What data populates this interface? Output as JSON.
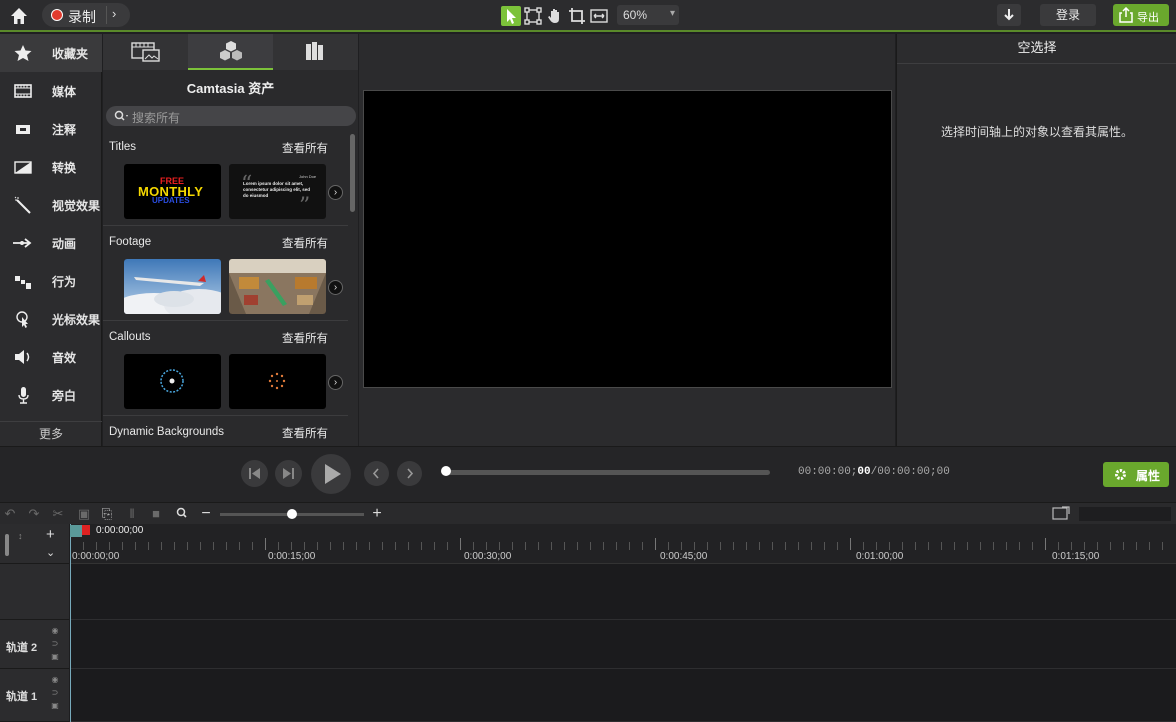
{
  "topbar": {
    "record_label": "录制",
    "zoom": "60%",
    "login_label": "登录",
    "export_label": "导出",
    "tools": [
      "select-icon",
      "transform-icon",
      "pan-icon",
      "crop-icon",
      "fit-icon"
    ]
  },
  "nav": {
    "items": [
      {
        "label": "收藏夹",
        "icon": "star-icon"
      },
      {
        "label": "媒体",
        "icon": "film-icon"
      },
      {
        "label": "注释",
        "icon": "callout-icon"
      },
      {
        "label": "转换",
        "icon": "transition-icon"
      },
      {
        "label": "视觉效果",
        "icon": "magic-wand-icon"
      },
      {
        "label": "动画",
        "icon": "animation-arrow-icon"
      },
      {
        "label": "行为",
        "icon": "behavior-icon"
      },
      {
        "label": "光标效果",
        "icon": "cursor-icon"
      },
      {
        "label": "音效",
        "icon": "speaker-icon"
      },
      {
        "label": "旁白",
        "icon": "microphone-icon"
      }
    ],
    "more_label": "更多"
  },
  "assets": {
    "title": "Camtasia 资产",
    "search_placeholder": "搜索所有",
    "sections": [
      {
        "title": "Titles",
        "view_all": "查看所有"
      },
      {
        "title": "Footage",
        "view_all": "查看所有"
      },
      {
        "title": "Callouts",
        "view_all": "查看所有"
      },
      {
        "title": "Dynamic Backgrounds",
        "view_all": "查看所有"
      }
    ],
    "thumb_text": {
      "monthly_free": "FREE",
      "monthly_main": "MONTHLY",
      "monthly_sub": "UPDATES",
      "quote_author": "John Doe",
      "quote_body": "Lorem ipsum dolor sit amet, consectetur adipiscing elit, sed do eiusmod"
    }
  },
  "properties": {
    "title": "空选择",
    "message": "选择时间轴上的对象以查看其属性。",
    "button_label": "属性"
  },
  "player": {
    "time_current_prefix": "00:00:00;",
    "time_current_frames": "00",
    "time_total": "/00:00:00;00",
    "progress": 0
  },
  "timeline": {
    "playhead_time": "0:00:00;00",
    "ruler_labels": [
      "0:00:00;00",
      "0:00:15;00",
      "0:00:30;00",
      "0:00:45;00",
      "0:01:00;00",
      "0:01:15;00"
    ],
    "tracks": [
      "轨道 2",
      "轨道 1"
    ]
  }
}
